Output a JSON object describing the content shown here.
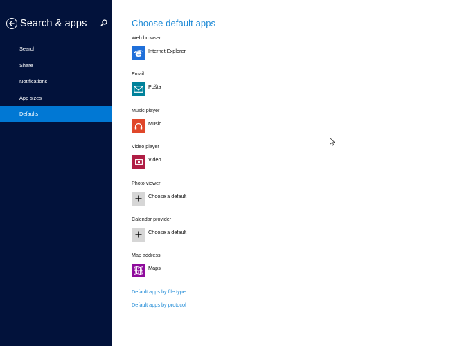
{
  "sidebar": {
    "title": "Search & apps",
    "back_icon": "back-arrow-circle-icon",
    "search_icon": "search-icon",
    "items": [
      {
        "label": "Search",
        "active": false
      },
      {
        "label": "Share",
        "active": false
      },
      {
        "label": "Notifications",
        "active": false
      },
      {
        "label": "App sizes",
        "active": false
      },
      {
        "label": "Defaults",
        "active": true
      }
    ],
    "colors": {
      "background": "#02123b",
      "active": "#0178d4"
    }
  },
  "main": {
    "title": "Choose default apps",
    "sections": [
      {
        "label": "Web browser",
        "app": "Internet Explorer",
        "icon": "internet-explorer-icon",
        "tile_color": "#1f6fd9"
      },
      {
        "label": "Email",
        "app": "Pošta",
        "icon": "mail-icon",
        "tile_color": "#00829b"
      },
      {
        "label": "Music player",
        "app": "Music",
        "icon": "headphones-icon",
        "tile_color": "#e0472a"
      },
      {
        "label": "Video player",
        "app": "Video",
        "icon": "video-icon",
        "tile_color": "#b01e45"
      },
      {
        "label": "Photo viewer",
        "app": "Choose a default",
        "icon": "plus-icon",
        "tile_color": "#d6d6d6"
      },
      {
        "label": "Calendar provider",
        "app": "Choose a default",
        "icon": "plus-icon",
        "tile_color": "#d6d6d6"
      },
      {
        "label": "Map address",
        "app": "Maps",
        "icon": "maps-icon",
        "tile_color": "#8f0b9c"
      }
    ],
    "links": [
      {
        "label": "Default apps by file type"
      },
      {
        "label": "Default apps by protocol"
      }
    ],
    "accent_color": "#1e8ad6"
  }
}
